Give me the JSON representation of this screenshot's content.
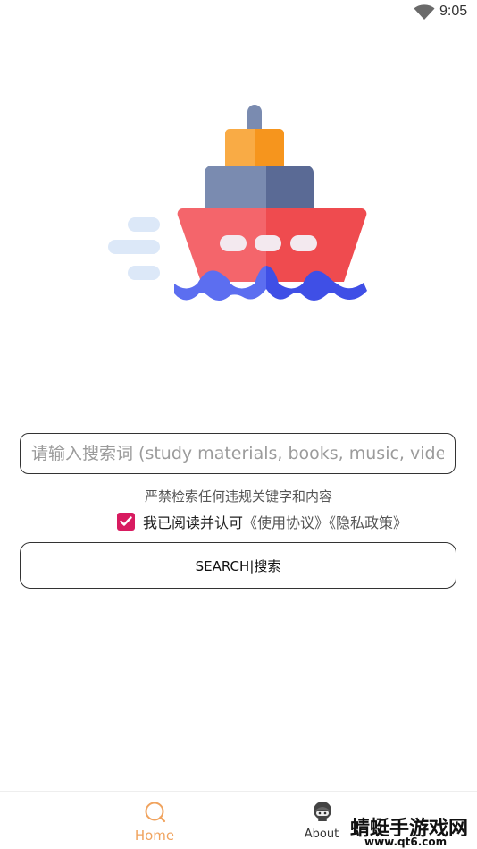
{
  "status_bar": {
    "time": "9:05",
    "wifi_icon": "wifi-icon"
  },
  "logo": {
    "icon": "ship-icon",
    "colors": {
      "hull_left": "#f4656b",
      "hull_right": "#ef4b4f",
      "cabin_left": "#7a8bb0",
      "cabin_right": "#5a6a95",
      "top_left": "#f9ab45",
      "top_right": "#f6951d",
      "waves_left": "#5c6ef0",
      "waves_right": "#3f4fe6",
      "speed_lines": "#dce8f8"
    }
  },
  "search": {
    "placeholder": "请输入搜索词 (study materials, books, music, videos, t",
    "value": ""
  },
  "warning": "严禁检索任何违规关键字和内容",
  "agreement": {
    "checked": true,
    "text": "我已阅读并认可",
    "links": "《使用协议》《隐私政策》",
    "accent_color": "#d81b60"
  },
  "search_button": {
    "label": "SEARCH|搜索"
  },
  "bottom_nav": {
    "items": [
      {
        "label": "Home",
        "icon": "search-icon",
        "active": true
      },
      {
        "label": "About",
        "icon": "ghost-avatar-icon",
        "active": false
      }
    ],
    "active_color": "#f0a35e"
  },
  "watermark": {
    "title": "蜻蜓手游戏网",
    "url": "www.qt6.com"
  }
}
